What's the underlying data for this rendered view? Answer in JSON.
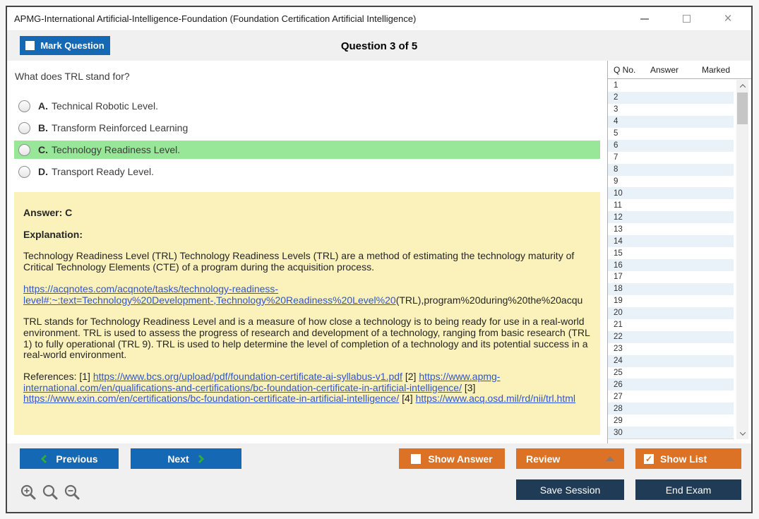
{
  "window": {
    "title": "APMG-International Artificial-Intelligence-Foundation (Foundation Certification Artificial Intelligence)",
    "close_glyph": "×"
  },
  "header": {
    "mark_question_label": "Mark Question",
    "question_counter": "Question 3 of 5"
  },
  "question": {
    "text": "What does TRL stand for?",
    "options": [
      {
        "letter": "A.",
        "text": "Technical Robotic Level.",
        "highlighted": false
      },
      {
        "letter": "B.",
        "text": "Transform Reinforced Learning",
        "highlighted": false
      },
      {
        "letter": "C.",
        "text": "Technology Readiness Level.",
        "highlighted": true
      },
      {
        "letter": "D.",
        "text": "Transport Ready Level.",
        "highlighted": false
      }
    ]
  },
  "explanation": {
    "answer_label": "Answer: C",
    "explanation_label": "Explanation:",
    "paragraph1": "Technology Readiness Level (TRL) Technology Readiness Levels (TRL) are a method of estimating the technology maturity of Critical Technology Elements (CTE) of a program during the acquisition process.",
    "link1_line1": "https://acqnotes.com/acqnote/tasks/technology-readiness-",
    "link1_line2": "level#:~:text=Technology%20Development-,Technology%20Readiness%20Level%20",
    "link1_tail": "(TRL),program%20during%20the%20acqu",
    "paragraph2": "TRL stands for Technology Readiness Level and is a measure of how close a technology is to being ready for use in a real-world environment. TRL is used to assess the progress of research and development of a technology, ranging from basic research (TRL 1) to fully operational (TRL 9). TRL is used to help determine the level of completion of a technology and its potential success in a real-world environment.",
    "references": {
      "prefix": "References: [1] ",
      "link1": "https://www.bcs.org/upload/pdf/foundation-certificate-ai-syllabus-v1.pdf",
      "sep1": " [2] ",
      "link2": "https://www.apmg-international.com/en/qualifications-and-certifications/bc-foundation-certificate-in-artificial-intelligence/",
      "sep2": " [3] ",
      "link3": "https://www.exin.com/en/certifications/bc-foundation-certificate-in-artificial-intelligence/",
      "sep3": " [4] ",
      "link4": "https://www.acq.osd.mil/rd/nii/trl.html"
    }
  },
  "question_list": {
    "headers": [
      "Q No.",
      "Answer",
      "Marked"
    ],
    "rows": [
      "1",
      "2",
      "3",
      "4",
      "5",
      "6",
      "7",
      "8",
      "9",
      "10",
      "11",
      "12",
      "13",
      "14",
      "15",
      "16",
      "17",
      "18",
      "19",
      "20",
      "21",
      "22",
      "23",
      "24",
      "25",
      "26",
      "27",
      "28",
      "29",
      "30"
    ]
  },
  "footer": {
    "previous_label": "Previous",
    "next_label": "Next",
    "show_answer_label": "Show Answer",
    "review_label": "Review",
    "show_list_label": "Show List",
    "show_list_check": "✓",
    "save_session_label": "Save Session",
    "end_exam_label": "End Exam"
  },
  "colors": {
    "accent_blue": "#1568B3",
    "accent_orange": "#DC7226",
    "accent_navy": "#1F3B55",
    "correct_highlight": "#98E698",
    "explanation_bg": "#FAF1BB",
    "link_blue": "#3355CC",
    "alt_row": "#EAF2F9"
  }
}
